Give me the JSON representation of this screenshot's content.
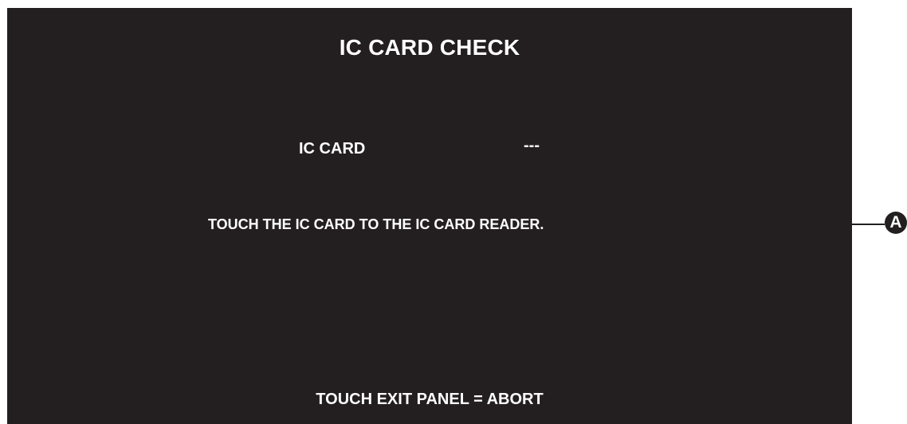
{
  "screen": {
    "title": "IC CARD CHECK",
    "ic_card": {
      "label": "IC CARD",
      "value": "---"
    },
    "instruction": "TOUCH THE IC CARD TO THE IC CARD READER.",
    "abort_hint": "TOUCH EXIT PANEL = ABORT"
  },
  "annotation": {
    "callout_letter": "A"
  },
  "colors": {
    "screen_background": "#231f20",
    "screen_text": "#ffffff",
    "page_background": "#ffffff"
  }
}
